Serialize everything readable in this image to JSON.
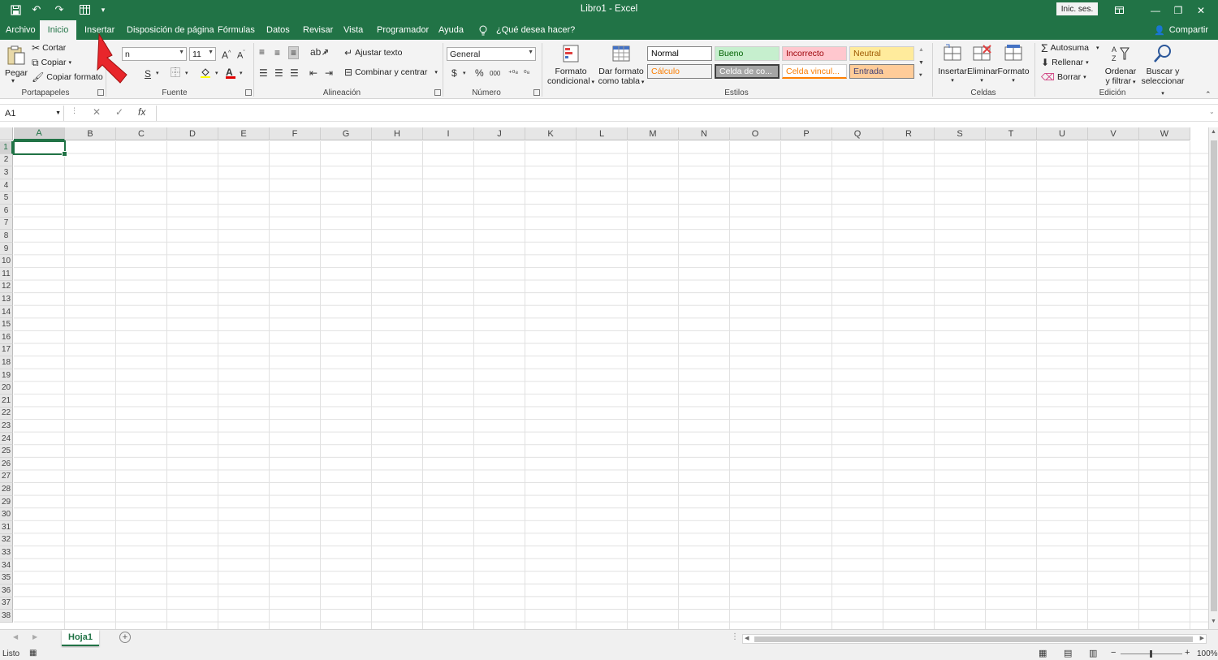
{
  "titlebar": {
    "title": "Libro1  -  Excel",
    "signin": "Inic. ses.",
    "qat_icons": [
      "save-icon",
      "undo-icon",
      "redo-icon",
      "form-icon",
      "customize-icon"
    ]
  },
  "tabs": {
    "items": [
      "Archivo",
      "Inicio",
      "Insertar",
      "Disposición de página",
      "Fórmulas",
      "Datos",
      "Revisar",
      "Vista",
      "Programador",
      "Ayuda"
    ],
    "active": "Inicio",
    "tellme": "¿Qué desea hacer?",
    "share": "Compartir"
  },
  "ribbon": {
    "clipboard": {
      "label": "Portapapeles",
      "paste": "Pegar",
      "cut": "Cortar",
      "copy": "Copiar",
      "format_painter": "Copiar formato"
    },
    "font": {
      "label": "Fuente",
      "name": "n",
      "size": "11"
    },
    "alignment": {
      "label": "Alineación",
      "wrap": "Ajustar texto",
      "merge": "Combinar y centrar"
    },
    "number": {
      "label": "Número",
      "format": "General"
    },
    "styles": {
      "label": "Estilos",
      "conditional": "Formato condicional",
      "as_table": "Dar formato como tabla",
      "cells": [
        {
          "name": "Normal",
          "bg": "#ffffff",
          "fg": "#000000"
        },
        {
          "name": "Bueno",
          "bg": "#c6efce",
          "fg": "#006100"
        },
        {
          "name": "Incorrecto",
          "bg": "#ffc7ce",
          "fg": "#9c0006"
        },
        {
          "name": "Neutral",
          "bg": "#ffeb9c",
          "fg": "#9c5700"
        },
        {
          "name": "Cálculo",
          "bg": "#f2f2f2",
          "fg": "#fa7d00"
        },
        {
          "name": "Celda de co...",
          "bg": "#a5a5a5",
          "fg": "#ffffff"
        },
        {
          "name": "Celda vincul...",
          "bg": "#ffffff",
          "fg": "#fa7d00"
        },
        {
          "name": "Entrada",
          "bg": "#ffcc99",
          "fg": "#3f3f76"
        }
      ]
    },
    "cells": {
      "label": "Celdas",
      "insert": "Insertar",
      "delete": "Eliminar",
      "format": "Formato"
    },
    "editing": {
      "label": "Edición",
      "autosum": "Autosuma",
      "fill": "Rellenar",
      "clear": "Borrar",
      "sort": "Ordenar y filtrar",
      "find": "Buscar y seleccionar"
    }
  },
  "formula_bar": {
    "name_box": "A1",
    "fx": "fx",
    "value": ""
  },
  "grid": {
    "columns": [
      "A",
      "B",
      "C",
      "D",
      "E",
      "F",
      "G",
      "H",
      "I",
      "J",
      "K",
      "L",
      "M",
      "N",
      "O",
      "P",
      "Q",
      "R",
      "S",
      "T",
      "U",
      "V",
      "W"
    ],
    "rows": [
      "1",
      "2",
      "3",
      "4",
      "5",
      "6",
      "7",
      "8",
      "9",
      "10",
      "11",
      "12",
      "13",
      "14",
      "15",
      "16",
      "17",
      "18",
      "19",
      "20",
      "21",
      "22",
      "23",
      "24",
      "25",
      "26",
      "27",
      "28",
      "29",
      "30",
      "31",
      "32",
      "33",
      "34",
      "35",
      "36",
      "37",
      "38"
    ],
    "selected": "A1"
  },
  "sheets": {
    "active": "Hoja1"
  },
  "status": {
    "ready": "Listo",
    "zoom": "100%"
  },
  "colors": {
    "accent": "#217346",
    "arrow": "#e8262b"
  }
}
